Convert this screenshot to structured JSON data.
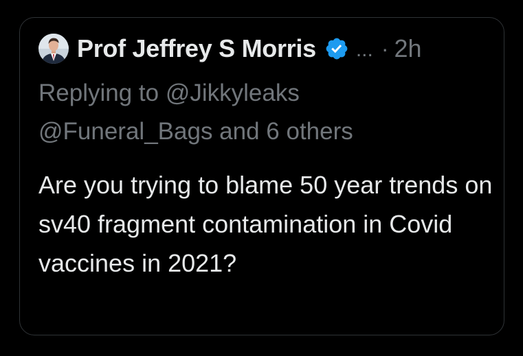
{
  "tweet": {
    "author_name": "Prof Jeffrey S Morris",
    "more_label": "...",
    "separator": "·",
    "timestamp": "2h",
    "replying_line1": "Replying to @Jikkyleaks",
    "replying_line2": "@Funeral_Bags and 6 others",
    "body": "Are you trying to blame 50 year trends on sv40 fragment contamination in Covid vaccines in 2021?"
  },
  "colors": {
    "background": "#000000",
    "card_border": "#2f3336",
    "text_primary": "#e7e9ea",
    "text_secondary": "#71767b",
    "verified_badge": "#1d9bf0"
  },
  "icons": {
    "avatar": "profile-photo",
    "verified": "verified-badge-icon",
    "more": "more-options-icon"
  }
}
